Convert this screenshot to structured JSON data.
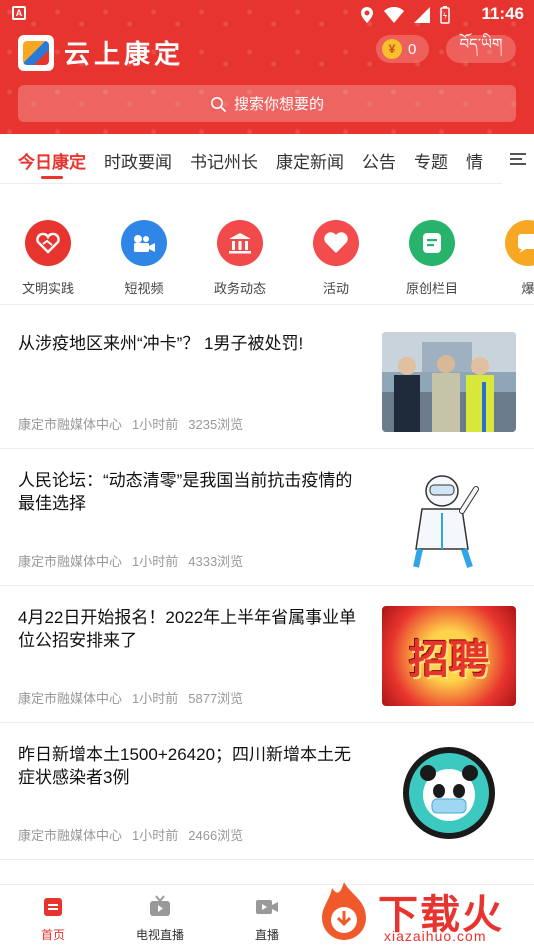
{
  "status_bar": {
    "time": "11:46",
    "app_icon": "A"
  },
  "header": {
    "app_title": "云上康定",
    "coin_symbol": "¥",
    "coin_count": "0",
    "lang_label": "བོད་ཡིག",
    "search_placeholder": "搜索你想要的"
  },
  "tabs": [
    "今日康定",
    "时政要闻",
    "书记州长",
    "康定新闻",
    "公告",
    "专题",
    "情"
  ],
  "shortcuts": [
    {
      "label": "文明实践",
      "icon": "heart-hands-icon",
      "color": "#e8342e"
    },
    {
      "label": "短视频",
      "icon": "video-camera-icon",
      "color": "#2f86e6"
    },
    {
      "label": "政务动态",
      "icon": "government-building-icon",
      "color": "#f04a4a"
    },
    {
      "label": "活动",
      "icon": "heart-icon",
      "color": "#f24c4c"
    },
    {
      "label": "原创栏目",
      "icon": "document-icon",
      "color": "#27b36b"
    },
    {
      "label": "爆",
      "icon": "message-icon",
      "color": "#f7a823"
    }
  ],
  "news": [
    {
      "title": "从涉疫地区来州“冲卡”？ 1男子被处罚!",
      "source": "康定市融媒体中心",
      "time": "1小时前",
      "views": "3235浏览"
    },
    {
      "title": " 人民论坛：“动态清零”是我国当前抗击疫情的最佳选择",
      "source": "康定市融媒体中心",
      "time": "1小时前",
      "views": "4333浏览"
    },
    {
      "title": "4月22日开始报名！2022年上半年省属事业单位公招安排来了",
      "source": "康定市融媒体中心",
      "time": "1小时前",
      "views": "5877浏览",
      "thumb_text": "招聘"
    },
    {
      "title": "昨日新增本土1500+26420；四川新增本土无症状感染者3例",
      "source": "康定市融媒体中心",
      "time": "1小时前",
      "views": "2466浏览"
    }
  ],
  "bottom_nav": [
    {
      "label": "首页",
      "icon": "home-icon",
      "active": true
    },
    {
      "label": "电视直播",
      "icon": "tv-icon",
      "active": false
    },
    {
      "label": "直播",
      "icon": "live-video-icon",
      "active": false
    }
  ],
  "watermark": {
    "text": "下载火",
    "sub": "xiazaihuo.com"
  },
  "colors": {
    "brand_red": "#e8342e"
  }
}
